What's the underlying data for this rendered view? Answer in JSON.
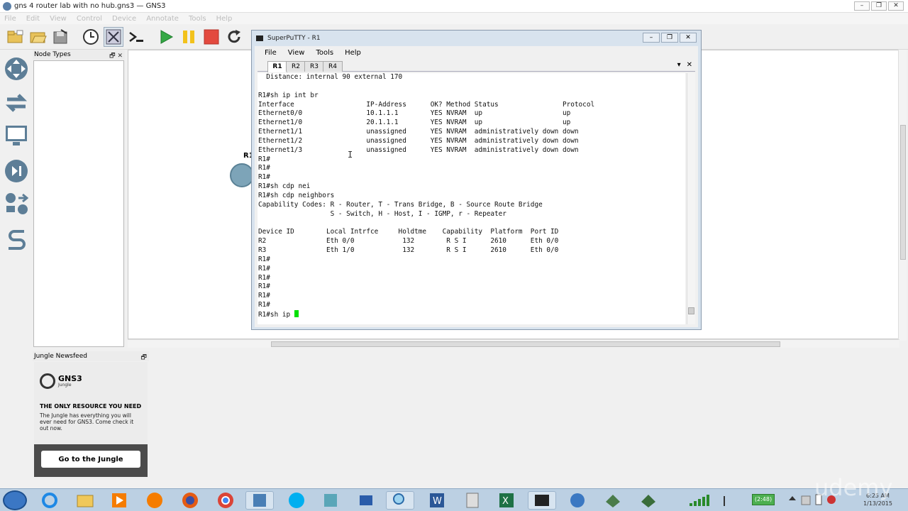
{
  "window": {
    "title": "gns 4 router lab with no hub.gns3 — GNS3"
  },
  "menubar": [
    "File",
    "Edit",
    "View",
    "Control",
    "Device",
    "Annotate",
    "Tools",
    "Help"
  ],
  "panels": {
    "node_types": "Node Types",
    "newsfeed": "Jungle Newsfeed"
  },
  "jungle": {
    "brand": "GNS3",
    "brand_sub": "Jungle",
    "headline": "THE ONLY RESOURCE YOU NEED",
    "text": "The Jungle has everything you will ever need for GNS3. Come check it out now.",
    "button": "Go to the Jungle"
  },
  "workspace": {
    "router_label": "R1"
  },
  "putty": {
    "title": "SuperPuTTY - R1",
    "menu": [
      "File",
      "View",
      "Tools",
      "Help"
    ],
    "tabs": [
      "R1",
      "R2",
      "R3",
      "R4"
    ],
    "active_tab": "R1",
    "terminal_lines": [
      "  Distance: internal 90 external 170",
      "",
      "R1#sh ip int br",
      "Interface                  IP-Address      OK? Method Status                Protocol",
      "Ethernet0/0                10.1.1.1        YES NVRAM  up                    up",
      "Ethernet1/0                20.1.1.1        YES NVRAM  up                    up",
      "Ethernet1/1                unassigned      YES NVRAM  administratively down down",
      "Ethernet1/2                unassigned      YES NVRAM  administratively down down",
      "Ethernet1/3                unassigned      YES NVRAM  administratively down down",
      "R1#",
      "R1#",
      "R1#",
      "R1#sh cdp nei",
      "R1#sh cdp neighbors",
      "Capability Codes: R - Router, T - Trans Bridge, B - Source Route Bridge",
      "                  S - Switch, H - Host, I - IGMP, r - Repeater",
      "",
      "Device ID        Local Intrfce     Holdtme    Capability  Platform  Port ID",
      "R2               Eth 0/0            132        R S I      2610      Eth 0/0",
      "R3               Eth 1/0            132        R S I      2610      Eth 0/0",
      "R1#",
      "R1#",
      "R1#",
      "R1#",
      "R1#",
      "R1#"
    ],
    "prompt_line": "R1#sh ip "
  },
  "taskbar": {
    "battery": "(2:48)",
    "clock_time": "6:25 AM",
    "clock_date": "1/13/2015"
  },
  "watermark": "udemy"
}
